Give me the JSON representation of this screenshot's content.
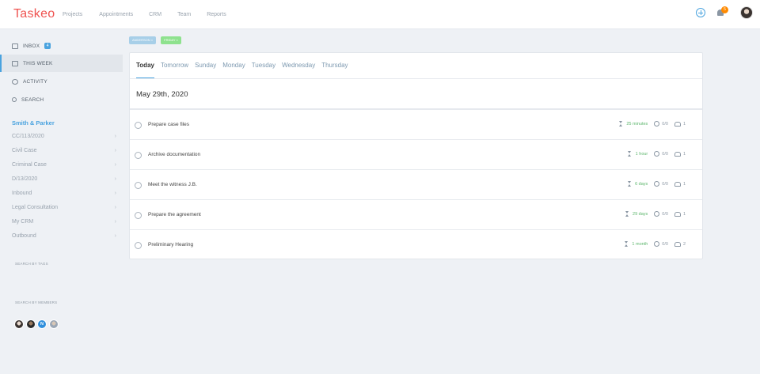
{
  "app": {
    "logo": "Taskeo"
  },
  "nav": {
    "items": [
      "Projects",
      "Appointments",
      "CRM",
      "Team",
      "Reports"
    ]
  },
  "header": {
    "notifications_count": "5"
  },
  "sidebar": {
    "inbox": {
      "label": "INBOX",
      "count": "4"
    },
    "this_week": {
      "label": "THIS WEEK"
    },
    "activity": {
      "label": "ACTIVITY"
    },
    "search": {
      "label": "SEARCH"
    },
    "group_title": "Smith & Parker",
    "projects": [
      "CC/113/2020",
      "Civil Case",
      "Criminal Case",
      "D/13/2020",
      "Inbound",
      "Legal Consultation",
      "My CRM",
      "Outbound"
    ],
    "search_by_tags": "SEARCH BY TAGS",
    "search_by_members": "SEARCH BY MEMBERS",
    "members": [
      {
        "initial": ""
      },
      {
        "initial": ""
      },
      {
        "initial": "N"
      },
      {
        "initial": ""
      }
    ]
  },
  "filters": {
    "chips": [
      "ANDERSON ×",
      "FRIDAY ×"
    ]
  },
  "tabs": [
    "Today",
    "Tomorrow",
    "Sunday",
    "Monday",
    "Tuesday",
    "Wednesday",
    "Thursday"
  ],
  "date_heading": "May 29th, 2020",
  "tasks": [
    {
      "title": "Prepare case files",
      "estimate": "25 minutes",
      "subtasks": "0/0",
      "people": "1"
    },
    {
      "title": "Archive documentation",
      "estimate": "1 hour",
      "subtasks": "0/0",
      "people": "1"
    },
    {
      "title": "Meet the witness J.B.",
      "estimate": "6 days",
      "subtasks": "0/0",
      "people": "1"
    },
    {
      "title": "Prepare the agreement",
      "estimate": "29 days",
      "subtasks": "0/0",
      "people": "1"
    },
    {
      "title": "Preliminary Hearing",
      "estimate": "1 month",
      "subtasks": "0/0",
      "people": "2"
    }
  ],
  "colors": {
    "accent": "#4aa3df",
    "logo": "#ef5350",
    "estimate": "#5bb56b",
    "badge": "#ff8a00"
  }
}
